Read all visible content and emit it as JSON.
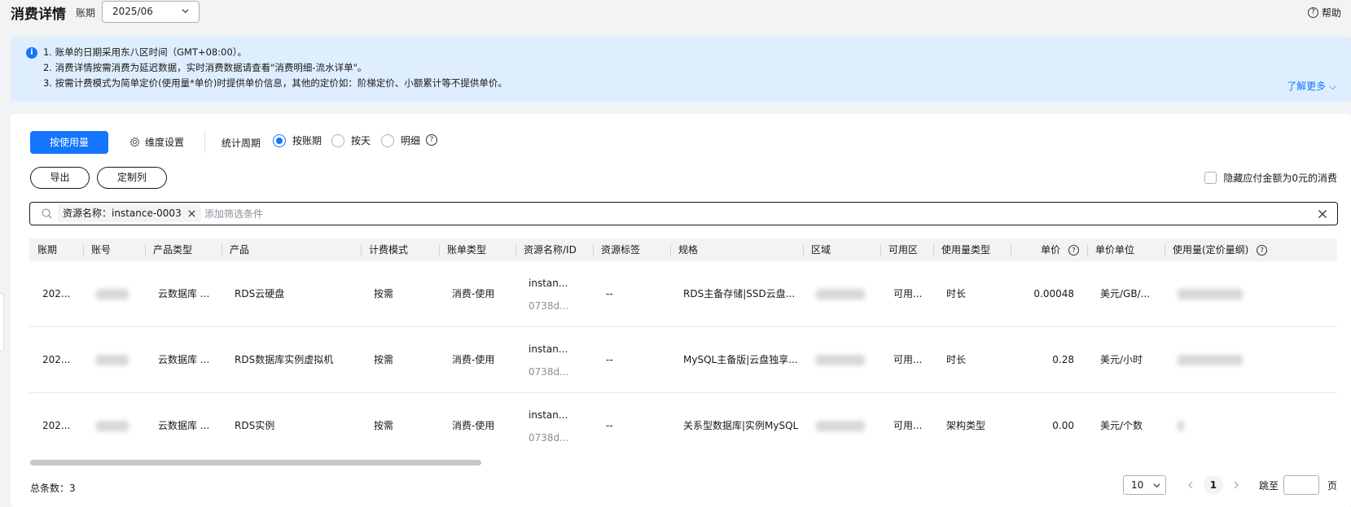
{
  "header": {
    "title": "消费详情",
    "period_label": "账期",
    "period_value": "2025/06",
    "help_label": "帮助"
  },
  "notice": {
    "lines": [
      "1. 账单的日期采用东八区时间（GMT+08:00）。",
      "2. 消费详情按需消费为延迟数据，实时消费数据请查看\"消费明细-流水详单\"。",
      "3. 按需计费模式为简单定价(使用量*单价)时提供单价信息，其他的定价如：阶梯定价、小额累计等不提供单价。"
    ],
    "more_label": "了解更多"
  },
  "toolbar": {
    "usage_button": "按使用量",
    "dimension_setting": "维度设置",
    "stat_period_label": "统计周期",
    "radios": [
      "按账期",
      "按天",
      "明细"
    ],
    "export_button": "导出",
    "custom_columns_button": "定制列",
    "hide_zero_label": "隐藏应付金额为0元的消费"
  },
  "filter": {
    "tag": "资源名称：instance-0003",
    "placeholder": "添加筛选条件"
  },
  "table": {
    "columns": [
      "账期",
      "账号",
      "产品类型",
      "产品",
      "计费模式",
      "账单类型",
      "资源名称/ID",
      "资源标签",
      "规格",
      "区域",
      "可用区",
      "使用量类型",
      "单价",
      "单价单位",
      "使用量(定价量纲)"
    ],
    "rows": [
      {
        "period": "202...",
        "product_type": "云数据库 ...",
        "product": "RDS云硬盘",
        "billing_mode": "按需",
        "bill_type": "消费-使用",
        "resource_name": "instan...",
        "resource_id": "0738d...",
        "tags": "--",
        "spec": "RDS主备存储|SSD云盘...",
        "az": "可用...",
        "usage_type": "时长",
        "unit_price": "0.00048",
        "price_unit": "美元/GB/..."
      },
      {
        "period": "202...",
        "product_type": "云数据库 ...",
        "product": "RDS数据库实例虚拟机",
        "billing_mode": "按需",
        "bill_type": "消费-使用",
        "resource_name": "instan...",
        "resource_id": "0738d...",
        "tags": "--",
        "spec": "MySQL主备版|云盘独享...",
        "az": "可用...",
        "usage_type": "时长",
        "unit_price": "0.28",
        "price_unit": "美元/小时"
      },
      {
        "period": "202...",
        "product_type": "云数据库 ...",
        "product": "RDS实例",
        "billing_mode": "按需",
        "bill_type": "消费-使用",
        "resource_name": "instan...",
        "resource_id": "0738d...",
        "tags": "--",
        "spec": "关系型数据库|实例MySQL",
        "az": "可用...",
        "usage_type": "架构类型",
        "unit_price": "0.00",
        "price_unit": "美元/个数"
      }
    ]
  },
  "footer": {
    "total_label": "总条数：3",
    "page_size": "10",
    "current_page": "1",
    "jump_label": "跳至",
    "page_suffix": "页"
  },
  "colors": {
    "primary": "#1476ff",
    "notice_bg": "#dfeeff",
    "page_bg": "#f2f3f5"
  }
}
